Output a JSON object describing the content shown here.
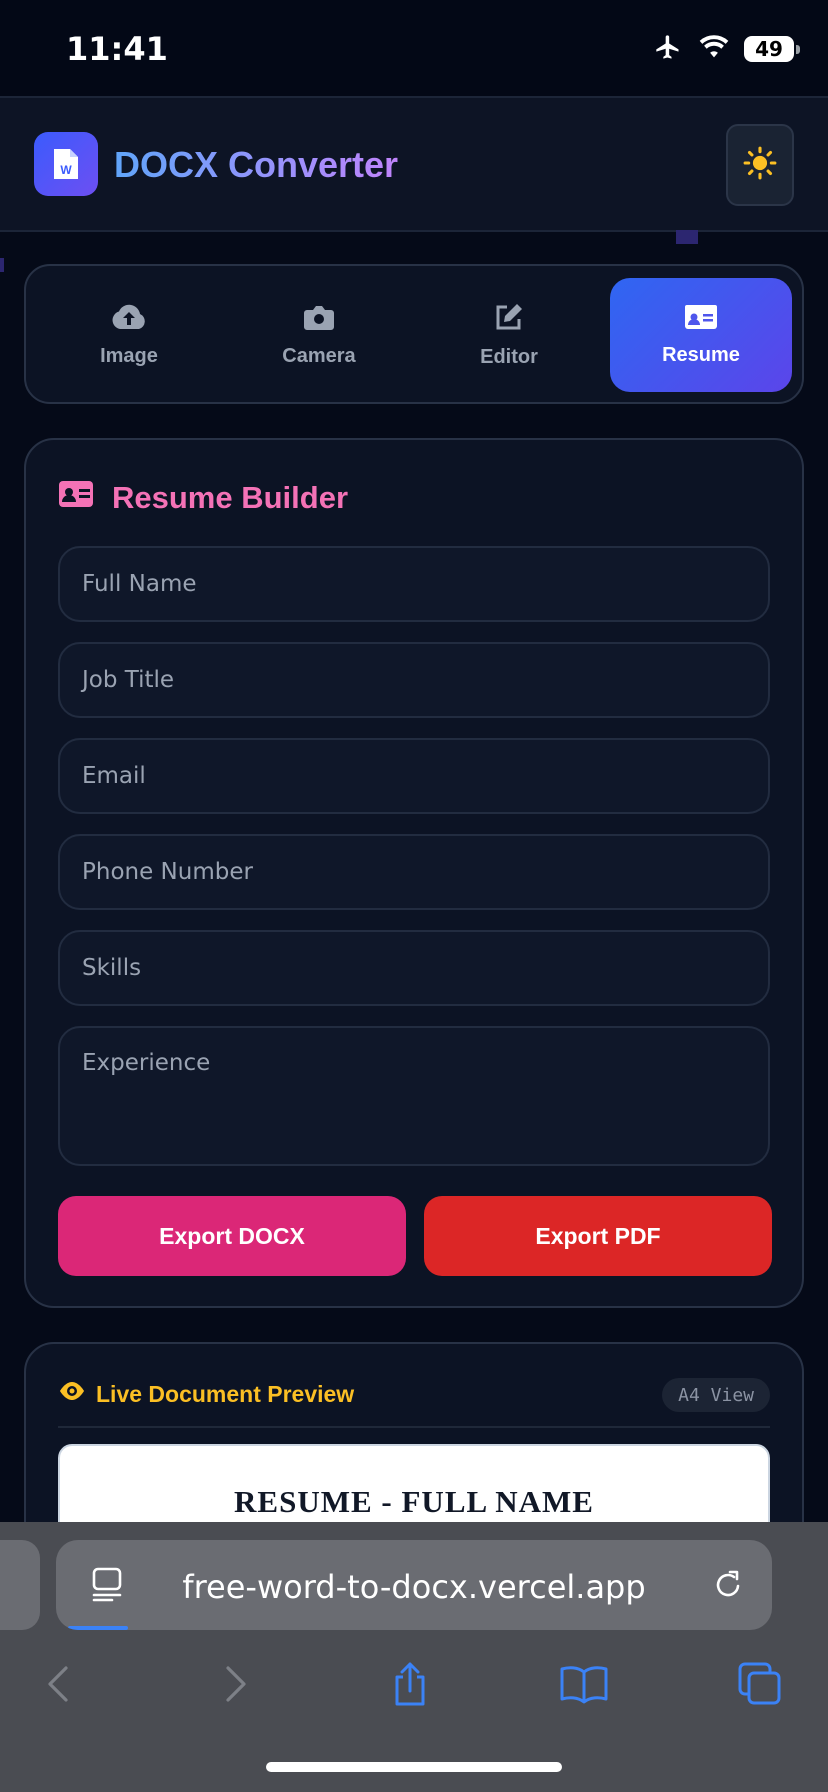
{
  "status_bar": {
    "time": "11:41",
    "battery": "49"
  },
  "header": {
    "title": "DOCX Converter",
    "logo_letter": "W"
  },
  "tabs": [
    {
      "label": "Image",
      "icon": "cloud-upload-icon",
      "active": false
    },
    {
      "label": "Camera",
      "icon": "camera-icon",
      "active": false
    },
    {
      "label": "Editor",
      "icon": "edit-icon",
      "active": false
    },
    {
      "label": "Resume",
      "icon": "id-card-icon",
      "active": true
    }
  ],
  "resume": {
    "title": "Resume Builder",
    "fields": {
      "full_name": "Full Name",
      "job_title": "Job Title",
      "email": "Email",
      "phone": "Phone Number",
      "skills": "Skills",
      "experience": "Experience"
    },
    "export_docx": "Export DOCX",
    "export_pdf": "Export PDF"
  },
  "preview": {
    "title": "Live Document Preview",
    "badge": "A4 View",
    "doc_heading": "RESUME - FULL NAME"
  },
  "browser": {
    "url": "free-word-to-docx.vercel.app"
  },
  "colors": {
    "accent_blue": "#2f66f2",
    "pink": "#f472b6",
    "docx_button": "#db2777",
    "pdf_button": "#dc2626",
    "preview_title": "#fbbf24"
  }
}
